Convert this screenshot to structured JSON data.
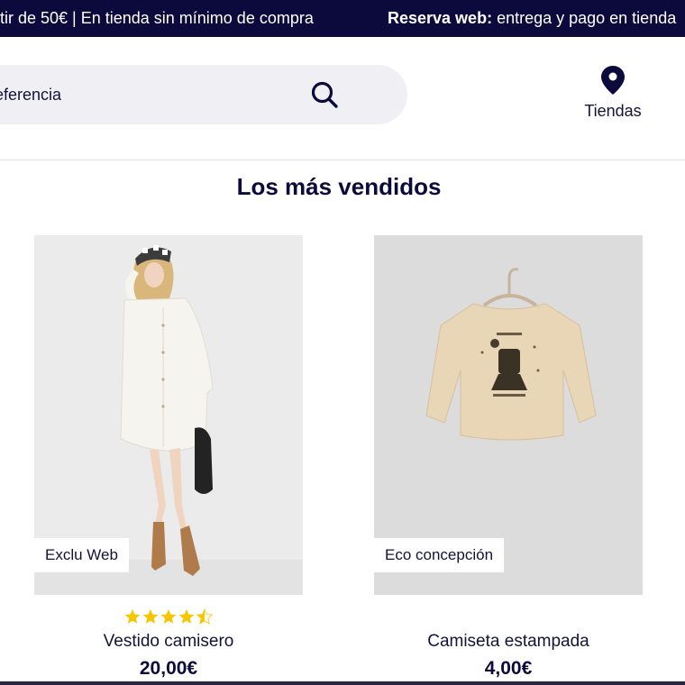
{
  "promo": {
    "message1": "rtir de 50€ | En tienda sin mínimo de compra",
    "message2_bold": "Reserva web:",
    "message2_rest": " entrega y pago en tienda"
  },
  "header": {
    "search_text": "eferencia",
    "search_icon": "search-icon",
    "stores_label": "Tiendas",
    "stores_icon": "map-pin-icon"
  },
  "section": {
    "title": "Los más vendidos"
  },
  "products": [
    {
      "badge": "Exclu Web",
      "rating": 4.5,
      "rating_max": 5,
      "name": "Vestido camisero",
      "price": "20,00€"
    },
    {
      "badge": "Eco concepción",
      "name": "Camiseta estampada",
      "price": "4,00€"
    }
  ],
  "colors": {
    "navy": "#0c0a3c",
    "search_bg": "#f0f0f4",
    "star": "#f7c600"
  }
}
